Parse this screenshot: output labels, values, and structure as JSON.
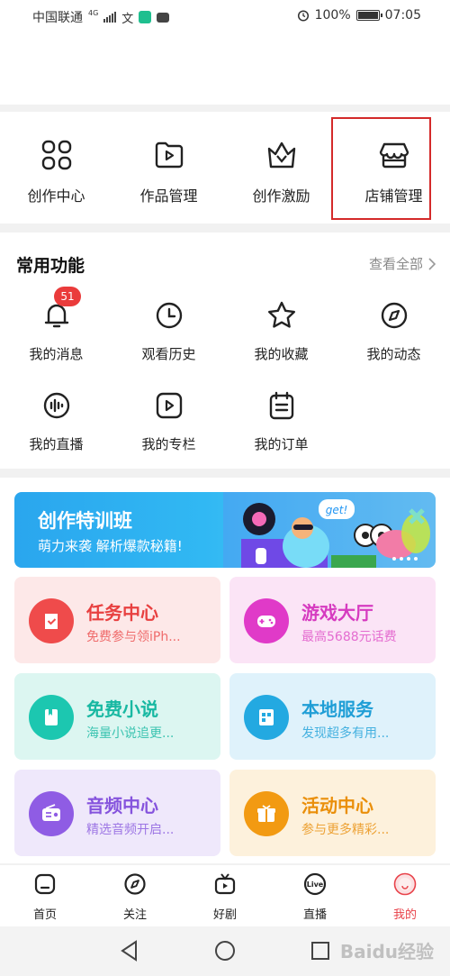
{
  "status_bar": {
    "carrier": "中国联通",
    "network": "4G",
    "battery": "100%",
    "time": "07:05"
  },
  "creator_tools": [
    {
      "label": "创作中心",
      "icon": "grid-icon"
    },
    {
      "label": "作品管理",
      "icon": "video-folder-icon"
    },
    {
      "label": "创作激励",
      "icon": "crown-icon"
    },
    {
      "label": "店铺管理",
      "icon": "store-icon"
    }
  ],
  "common": {
    "title": "常用功能",
    "view_all": "查看全部",
    "items": [
      {
        "label": "我的消息",
        "icon": "bell-icon",
        "badge": "51"
      },
      {
        "label": "观看历史",
        "icon": "clock-icon"
      },
      {
        "label": "我的收藏",
        "icon": "star-icon"
      },
      {
        "label": "我的动态",
        "icon": "compass-icon"
      },
      {
        "label": "我的直播",
        "icon": "live-wave-icon"
      },
      {
        "label": "我的专栏",
        "icon": "play-box-icon"
      },
      {
        "label": "我的订单",
        "icon": "order-icon"
      }
    ]
  },
  "banner": {
    "title": "创作特训班",
    "subtitle": "萌力来袭 解析爆款秘籍!",
    "bubble": "get!"
  },
  "tiles": [
    {
      "title": "任务中心",
      "subtitle": "免费参与领iPh...",
      "icon": "check-bag-icon",
      "bg": "#fde8e8",
      "circle": "#ef4b4b",
      "title_color": "#e84040",
      "sub_color": "#ef6b6b"
    },
    {
      "title": "游戏大厅",
      "subtitle": "最高5688元话费",
      "icon": "gamepad-icon",
      "bg": "#fbe4f6",
      "circle": "#e03ac8",
      "title_color": "#d63bc0",
      "sub_color": "#e46cd0"
    },
    {
      "title": "免费小说",
      "subtitle": "海量小说追更...",
      "icon": "book-icon",
      "bg": "#dcf6f1",
      "circle": "#1cc7b0",
      "title_color": "#18b8a2",
      "sub_color": "#3cc4b1"
    },
    {
      "title": "本地服务",
      "subtitle": "发现超多有用...",
      "icon": "building-icon",
      "bg": "#dff2fb",
      "circle": "#23a9e1",
      "title_color": "#1f9ed6",
      "sub_color": "#45b1e0"
    },
    {
      "title": "音频中心",
      "subtitle": "精选音频开启...",
      "icon": "radio-icon",
      "bg": "#efe8fb",
      "circle": "#8f5ce4",
      "title_color": "#8553dd",
      "sub_color": "#9d76e4"
    },
    {
      "title": "活动中心",
      "subtitle": "参与更多精彩...",
      "icon": "gift-icon",
      "bg": "#fdf1dc",
      "circle": "#f29a12",
      "title_color": "#ea8f0a",
      "sub_color": "#eda235"
    }
  ],
  "tabbar": [
    {
      "label": "首页",
      "icon": "home-icon"
    },
    {
      "label": "关注",
      "icon": "compass-icon"
    },
    {
      "label": "好剧",
      "icon": "tv-icon"
    },
    {
      "label": "直播",
      "icon": "live-icon",
      "badge_text": "Live"
    },
    {
      "label": "我的",
      "icon": "avatar-icon",
      "active": true,
      "active_color": "#e8424a"
    }
  ],
  "watermark": "Baidu经验"
}
